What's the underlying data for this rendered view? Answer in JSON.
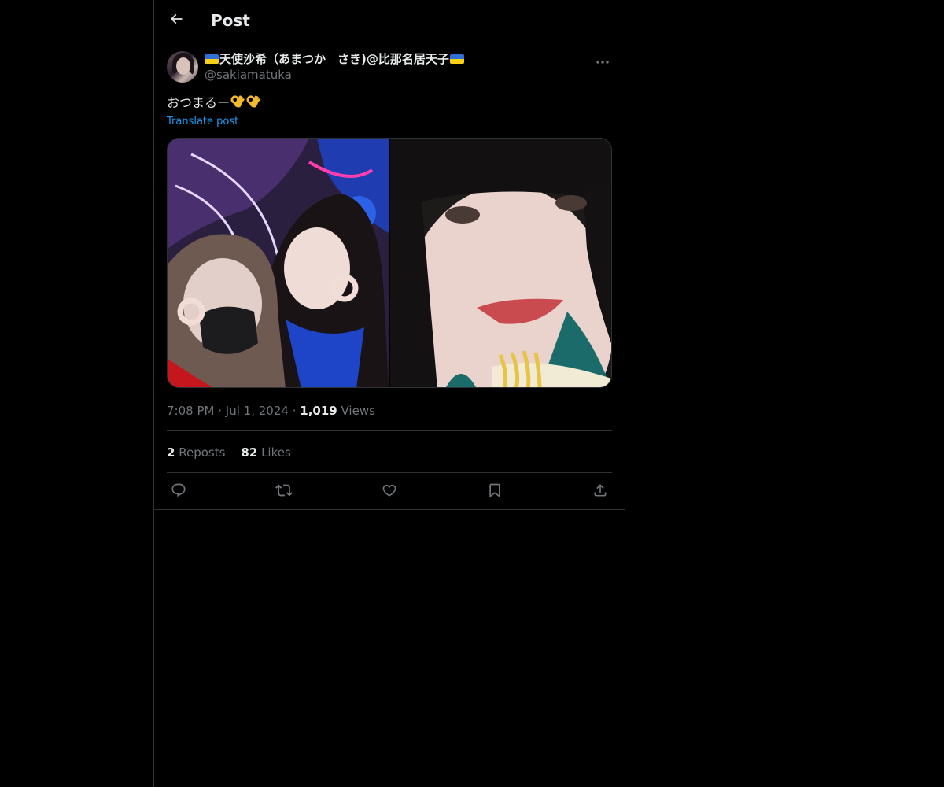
{
  "header": {
    "title": "Post",
    "back_icon": "arrow-left-icon"
  },
  "post": {
    "display_name": "天使沙希（あまつか　さき)@比那名居天子",
    "name_flag_colors": [
      "#2f6fd6",
      "#f7d117"
    ],
    "handle": "@sakiamatuka",
    "text": "おつまるー",
    "text_emoji": "ok-hand-emoji",
    "translate_label": "Translate post",
    "time": "7:08 PM",
    "date": "Jul 1, 2024",
    "separator": "·",
    "views_count": "1,019",
    "views_label": "Views",
    "reposts_count": "2",
    "reposts_label": "Reposts",
    "likes_count": "82",
    "likes_label": "Likes"
  },
  "actions": [
    "reply-icon",
    "repost-icon",
    "like-icon",
    "bookmark-icon",
    "share-icon"
  ],
  "colors": {
    "background": "#000000",
    "text": "#e7e9ea",
    "secondary": "#71767b",
    "link": "#1d9bf0",
    "border": "#2f3336"
  }
}
